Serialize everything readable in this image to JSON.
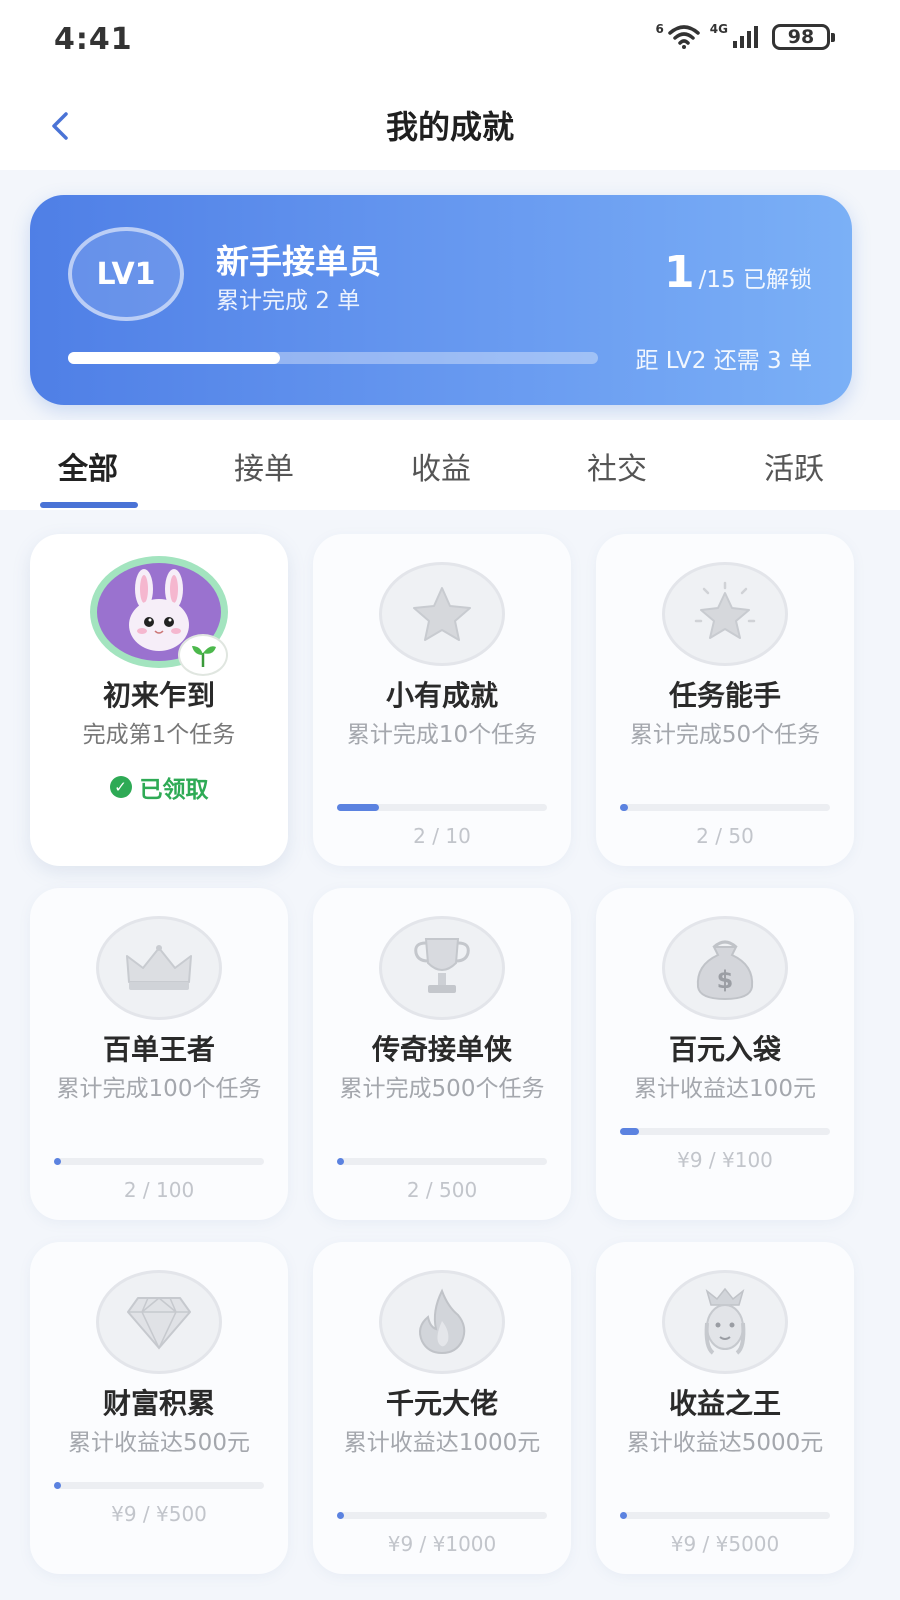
{
  "status_bar": {
    "time": "4:41",
    "battery": "98",
    "network": "4G",
    "wifi_tag": "6",
    "icons": [
      "wifi-icon",
      "signal-icon",
      "battery-icon"
    ]
  },
  "header": {
    "title": "我的成就",
    "back_icon": "chevron-left-icon"
  },
  "level_card": {
    "level": "LV1",
    "name": "新手接单员",
    "subtitle": "累计完成 2 单",
    "unlocked_count": "1",
    "unlocked_total": "/15 已解锁",
    "next_level_text": "距 LV2 还需 3 单",
    "progress_fraction": 0.4
  },
  "tabs": [
    {
      "label": "全部",
      "active": true
    },
    {
      "label": "接单",
      "active": false
    },
    {
      "label": "收益",
      "active": false
    },
    {
      "label": "社交",
      "active": false
    },
    {
      "label": "活跃",
      "active": false
    }
  ],
  "achievements": [
    {
      "title": "初来乍到",
      "desc": "完成第1个任务",
      "status": "已领取",
      "icon": "rabbit-avatar-icon",
      "unlocked": true
    },
    {
      "title": "小有成就",
      "desc": "累计完成10个任务",
      "progress_label": "2 / 10",
      "progress_fraction": 0.2,
      "icon": "star-icon"
    },
    {
      "title": "任务能手",
      "desc": "累计完成50个任务",
      "progress_label": "2 / 50",
      "progress_fraction": 0.04,
      "icon": "sparkle-star-icon"
    },
    {
      "title": "百单王者",
      "desc": "累计完成100个任务",
      "progress_label": "2 / 100",
      "progress_fraction": 0.02,
      "icon": "crown-icon"
    },
    {
      "title": "传奇接单侠",
      "desc": "累计完成500个任务",
      "progress_label": "2 / 500",
      "progress_fraction": 0.004,
      "icon": "trophy-icon"
    },
    {
      "title": "百元入袋",
      "desc": "累计收益达100元",
      "progress_label": "¥9 / ¥100",
      "progress_fraction": 0.09,
      "icon": "money-bag-icon"
    },
    {
      "title": "财富积累",
      "desc": "累计收益达500元",
      "progress_label": "¥9 / ¥500",
      "progress_fraction": 0.018,
      "icon": "diamond-icon"
    },
    {
      "title": "千元大佬",
      "desc": "累计收益达1000元",
      "progress_label": "¥9 / ¥1000",
      "progress_fraction": 0.009,
      "icon": "flame-icon"
    },
    {
      "title": "收益之王",
      "desc": "累计收益达5000元",
      "progress_label": "¥9 / ¥5000",
      "progress_fraction": 0.0018,
      "icon": "princess-icon"
    }
  ],
  "colors": {
    "accent": "#4a73d6",
    "card_gradient_start": "#4f7fe6",
    "card_gradient_end": "#7bb0f6",
    "claimed_green": "#2eaa55"
  }
}
